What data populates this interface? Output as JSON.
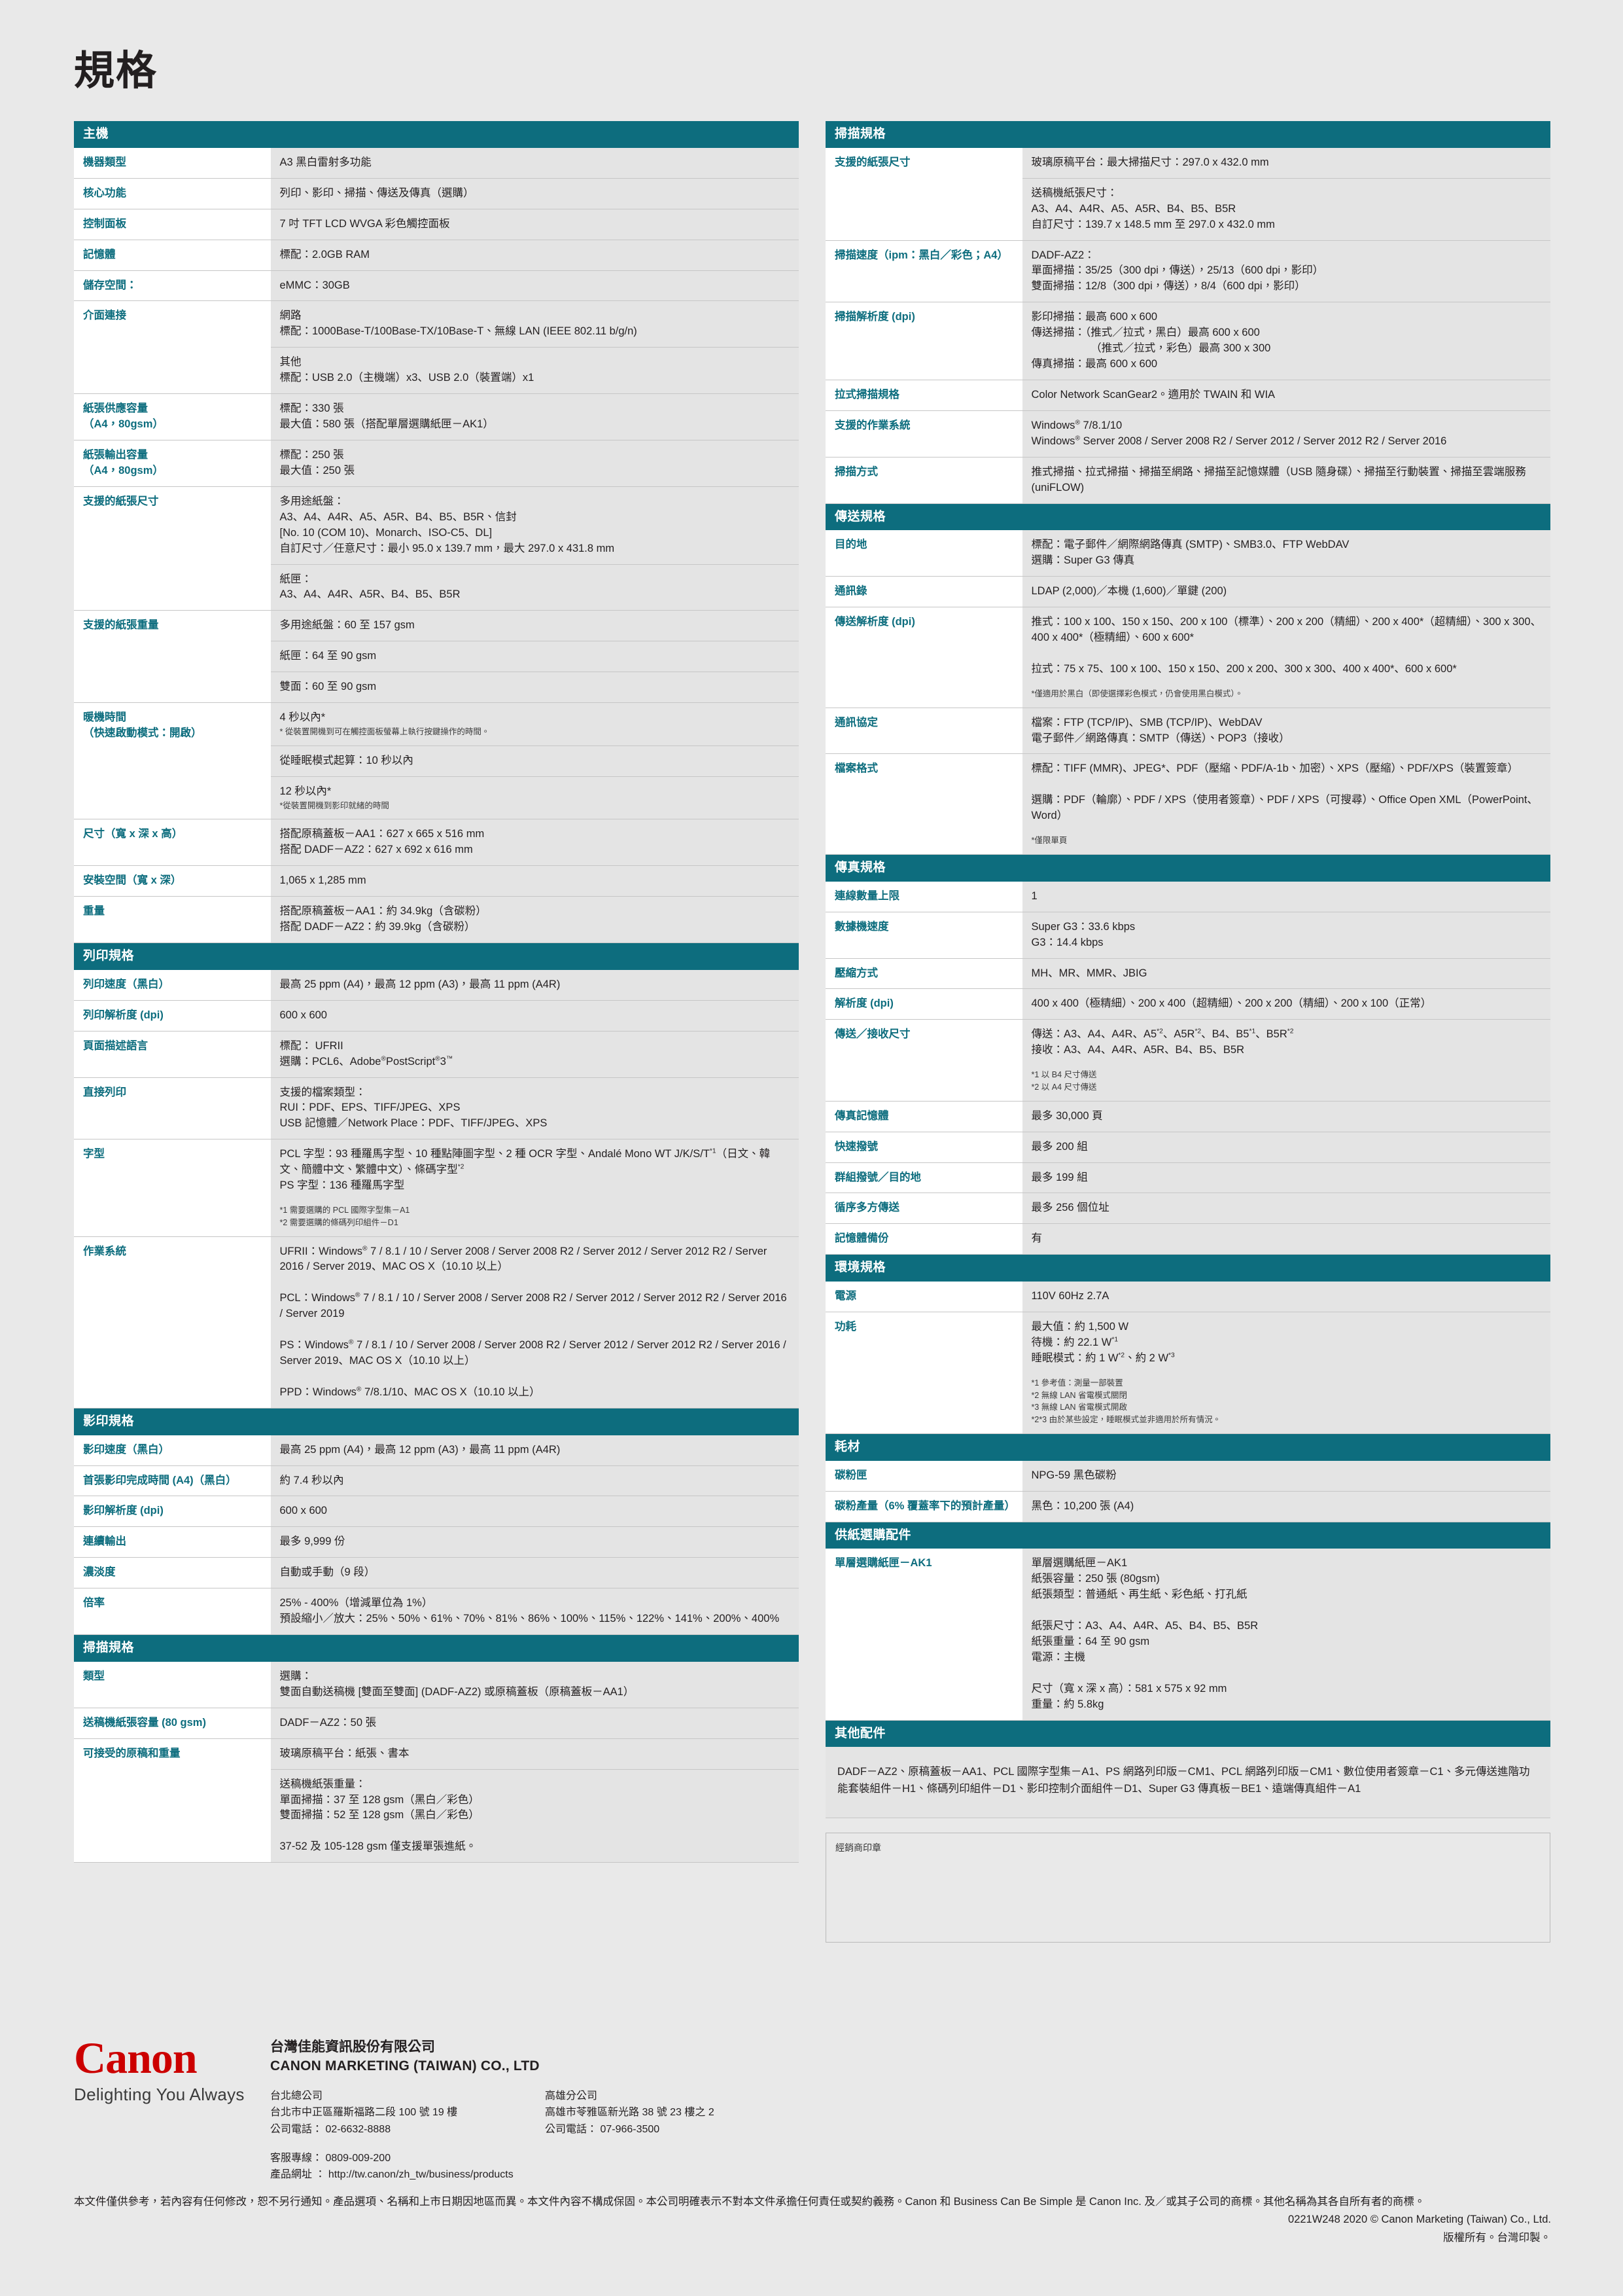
{
  "page_title": "規格",
  "colors": {
    "accent": "#0d6d7e",
    "brand": "#cc0000",
    "value_bg": "#e4e4e4",
    "page_bg": "#e9e9e9"
  },
  "left_column": [
    {
      "section": "主機",
      "rows": [
        {
          "key": "機器類型",
          "values": [
            "A3 黑白雷射多功能"
          ]
        },
        {
          "key": "核心功能",
          "values": [
            "列印、影印、掃描、傳送及傳真（選購）"
          ]
        },
        {
          "key": "控制面板",
          "values": [
            "7 吋 TFT LCD WVGA 彩色觸控面板"
          ]
        },
        {
          "key": "記憶體",
          "values": [
            "標配：2.0GB RAM"
          ]
        },
        {
          "key": "儲存空間：",
          "values": [
            "eMMC：30GB"
          ]
        },
        {
          "key": "介面連接",
          "values": [
            "網路\n標配：1000Base-T/100Base-TX/10Base-T、無線 LAN (IEEE 802.11 b/g/n)",
            "其他\n標配：USB 2.0（主機端）x3、USB 2.0（裝置端）x1"
          ]
        },
        {
          "key": "紙張供應容量\n（A4，80gsm）",
          "values": [
            "標配：330 張\n最大值：580 張（搭配單層選購紙匣－AK1）"
          ]
        },
        {
          "key": "紙張輸出容量\n（A4，80gsm）",
          "values": [
            "標配：250 張\n最大值：250 張"
          ]
        },
        {
          "key": "支援的紙張尺寸",
          "values": [
            "多用途紙盤：\nA3、A4、A4R、A5、A5R、B4、B5、B5R、信封\n[No. 10 (COM 10)、Monarch、ISO-C5、DL]\n自訂尺寸／任意尺寸：最小 95.0 x 139.7 mm，最大 297.0 x 431.8 mm",
            "紙匣：\nA3、A4、A4R、A5R、B4、B5、B5R"
          ]
        },
        {
          "key": "支援的紙張重量",
          "values": [
            "多用途紙盤：60 至 157 gsm",
            "紙匣：64 至 90 gsm",
            "雙面：60 至 90 gsm"
          ]
        },
        {
          "key": "暖機時間\n（快速啟動模式：開啟）",
          "values": [
            "4 秒以內*",
            "從睡眠模式起算：10 秒以內",
            "12 秒以內*"
          ],
          "value_notes": [
            "* 從裝置開機到可在觸控面板螢幕上執行按鍵操作的時間。",
            "",
            "*從裝置開機到影印就緒的時間"
          ]
        },
        {
          "key": "尺寸（寬 x 深 x 高）",
          "values": [
            "搭配原稿蓋板－AA1：627 x 665 x 516 mm\n搭配 DADF－AZ2：627 x 692 x 616 mm"
          ]
        },
        {
          "key": "安裝空間（寬 x 深）",
          "values": [
            "1,065 x 1,285 mm"
          ]
        },
        {
          "key": "重量",
          "values": [
            "搭配原稿蓋板－AA1：約 34.9kg（含碳粉）\n搭配 DADF－AZ2：約 39.9kg（含碳粉）"
          ]
        }
      ]
    },
    {
      "section": "列印規格",
      "rows": [
        {
          "key": "列印速度（黑白）",
          "values": [
            "最高 25 ppm (A4)，最高 12 ppm (A3)，最高 11 ppm (A4R)"
          ]
        },
        {
          "key": "列印解析度 (dpi)",
          "values": [
            "600 x 600"
          ]
        },
        {
          "key": "頁面描述語言",
          "values": [
            "標配： UFRII\n選購：PCL6、Adobe®PostScript®3™"
          ]
        },
        {
          "key": "直接列印",
          "values": [
            "支援的檔案類型：\nRUI：PDF、EPS、TIFF/JPEG、XPS\nUSB 記憶體／Network Place：PDF、TIFF/JPEG、XPS"
          ]
        },
        {
          "key": "字型",
          "values": [
            "PCL 字型：93 種羅馬字型、10 種點陣圖字型、2 種 OCR 字型、Andalé Mono WT J/K/S/T*1（日文、韓文、簡體中文、繁體中文）、條碼字型*2\nPS 字型：136 種羅馬字型"
          ],
          "value_notes": [
            "*1 需要選購的 PCL 國際字型集－A1\n*2 需要選購的條碼列印組件－D1"
          ]
        },
        {
          "key": "作業系統",
          "values": [
            "UFRII：Windows® 7 / 8.1 / 10 / Server 2008 / Server 2008 R2 / Server 2012 / Server 2012 R2 / Server 2016 / Server 2019、MAC OS X（10.10 以上）\n\nPCL：Windows® 7 / 8.1 / 10 / Server 2008 / Server 2008 R2 / Server 2012 / Server 2012 R2 / Server 2016 / Server 2019\n\nPS：Windows® 7 / 8.1 / 10 / Server 2008 / Server 2008 R2 / Server 2012 / Server 2012 R2 / Server 2016 / Server 2019、MAC OS X（10.10 以上）\n\nPPD：Windows® 7/8.1/10、MAC OS X（10.10 以上）"
          ]
        }
      ]
    },
    {
      "section": "影印規格",
      "rows": [
        {
          "key": "影印速度（黑白）",
          "values": [
            "最高 25 ppm (A4)，最高 12 ppm (A3)，最高 11 ppm (A4R)"
          ]
        },
        {
          "key": "首張影印完成時間 (A4)（黑白）",
          "values": [
            "約 7.4 秒以內"
          ]
        },
        {
          "key": "影印解析度 (dpi)",
          "values": [
            "600 x 600"
          ]
        },
        {
          "key": "連續輸出",
          "values": [
            "最多 9,999 份"
          ]
        },
        {
          "key": "濃淡度",
          "values": [
            "自動或手動（9 段）"
          ]
        },
        {
          "key": "倍率",
          "values": [
            "25% - 400%（增減單位為 1%）\n預設縮小／放大：25%、50%、61%、70%、81%、86%、100%、115%、122%、141%、200%、400%"
          ]
        }
      ]
    },
    {
      "section": "掃描規格",
      "rows": [
        {
          "key": "類型",
          "values": [
            "選購：\n雙面自動送稿機 [雙面至雙面] (DADF-AZ2) 或原稿蓋板（原稿蓋板－AA1）"
          ]
        },
        {
          "key": "送稿機紙張容量 (80 gsm)",
          "values": [
            "DADF－AZ2：50 張"
          ]
        },
        {
          "key": "可接受的原稿和重量",
          "values": [
            "玻璃原稿平台：紙張、書本",
            "送稿機紙張重量：\n單面掃描：37 至 128 gsm（黑白／彩色）\n雙面掃描：52 至 128 gsm（黑白／彩色）\n\n37-52 及 105-128 gsm 僅支援單張進紙。"
          ]
        }
      ]
    }
  ],
  "right_column": [
    {
      "section": "掃描規格",
      "rows": [
        {
          "key": "支援的紙張尺寸",
          "values": [
            "玻璃原稿平台：最大掃描尺寸：297.0 x 432.0 mm",
            "送稿機紙張尺寸：\nA3、A4、A4R、A5、A5R、B4、B5、B5R\n自訂尺寸：139.7 x 148.5 mm 至 297.0 x 432.0 mm"
          ]
        },
        {
          "key": "掃描速度（ipm：黑白／彩色；A4）",
          "values": [
            "DADF-AZ2：\n單面掃描：35/25（300 dpi，傳送），25/13（600 dpi，影印）\n雙面掃描：12/8（300 dpi，傳送），8/4（600 dpi，影印）"
          ]
        },
        {
          "key": "掃描解析度 (dpi)",
          "values": [
            "影印掃描：最高 600 x 600\n傳送掃描：（推式／拉式，黑白）最高 600 x 600\n　　　　　　（推式／拉式，彩色）最高 300 x 300\n傳真掃描：最高 600 x 600"
          ]
        },
        {
          "key": "拉式掃描規格",
          "values": [
            "Color Network ScanGear2。適用於 TWAIN 和 WIA"
          ]
        },
        {
          "key": "支援的作業系統",
          "values": [
            "Windows® 7/8.1/10\nWindows® Server 2008 / Server 2008 R2 / Server 2012 / Server 2012 R2 / Server 2016"
          ]
        },
        {
          "key": "掃描方式",
          "values": [
            "推式掃描、拉式掃描、掃描至網路、掃描至記憶媒體（USB 隨身碟）、掃描至行動裝置、掃描至雲端服務 (uniFLOW)"
          ]
        }
      ]
    },
    {
      "section": "傳送規格",
      "rows": [
        {
          "key": "目的地",
          "values": [
            "標配：電子郵件／網際網路傳真 (SMTP)、SMB3.0、FTP WebDAV\n選購：Super G3 傳真"
          ]
        },
        {
          "key": "通訊錄",
          "values": [
            "LDAP (2,000)／本機 (1,600)／單鍵 (200)"
          ]
        },
        {
          "key": "傳送解析度 (dpi)",
          "values": [
            "推式：100 x 100、150 x 150、200 x 100（標準）、200 x 200（精細）、200 x 400*（超精細）、300 x 300、400 x 400*（極精細）、600 x 600*\n\n拉式：75 x 75、100 x 100、150 x 150、200 x 200、300 x 300、400 x 400*、600 x 600*"
          ],
          "value_notes": [
            "*僅適用於黑白（即使選擇彩色模式，仍會使用黑白模式）。"
          ]
        },
        {
          "key": "通訊協定",
          "values": [
            "檔案：FTP (TCP/IP)、SMB (TCP/IP)、WebDAV\n電子郵件／網路傳真：SMTP（傳送）、POP3（接收）"
          ]
        },
        {
          "key": "檔案格式",
          "values": [
            "標配：TIFF (MMR)、JPEG*、PDF（壓縮、PDF/A-1b、加密）、XPS（壓縮）、PDF/XPS（裝置簽章）\n\n選購：PDF（輪廓）、PDF / XPS（使用者簽章）、PDF / XPS（可搜尋）、Office Open XML（PowerPoint、Word）"
          ],
          "value_notes": [
            "*僅限單頁"
          ]
        }
      ]
    },
    {
      "section": "傳真規格",
      "rows": [
        {
          "key": "連線數量上限",
          "values": [
            "1"
          ]
        },
        {
          "key": "數據機速度",
          "values": [
            "Super G3：33.6 kbps\nG3：14.4 kbps"
          ]
        },
        {
          "key": "壓縮方式",
          "values": [
            "MH、MR、MMR、JBIG"
          ]
        },
        {
          "key": "解析度 (dpi)",
          "values": [
            "400 x 400（極精細）、200 x 400（超精細）、200 x 200（精細）、200 x 100（正常）"
          ]
        },
        {
          "key": "傳送／接收尺寸",
          "values": [
            "傳送：A3、A4、A4R、A5*2、A5R*2、B4、B5*1、B5R*2\n接收：A3、A4、A4R、A5R、B4、B5、B5R"
          ],
          "value_notes": [
            "*1 以 B4 尺寸傳送\n*2 以 A4 尺寸傳送"
          ]
        },
        {
          "key": "傳真記憶體",
          "values": [
            "最多 30,000 頁"
          ]
        },
        {
          "key": "快速撥號",
          "values": [
            "最多 200 組"
          ]
        },
        {
          "key": "群組撥號／目的地",
          "values": [
            "最多 199 組"
          ]
        },
        {
          "key": "循序多方傳送",
          "values": [
            "最多 256 個位址"
          ]
        },
        {
          "key": "記憶體備份",
          "values": [
            "有"
          ]
        }
      ]
    },
    {
      "section": "環境規格",
      "rows": [
        {
          "key": "電源",
          "values": [
            "110V 60Hz 2.7A"
          ]
        },
        {
          "key": "功耗",
          "values": [
            "最大值：約 1,500 W\n待機：約 22.1 W*1\n睡眠模式：約 1 W*2、約 2 W*3"
          ],
          "value_notes": [
            "*1 參考值：測量一部裝置\n*2 無線 LAN 省電模式關閉\n*3 無線 LAN 省電模式開啟\n*2*3 由於某些設定，睡眠模式並非適用於所有情況。"
          ]
        }
      ]
    },
    {
      "section": "耗材",
      "rows": [
        {
          "key": "碳粉匣",
          "values": [
            "NPG-59 黑色碳粉"
          ]
        },
        {
          "key": "碳粉產量（6% 覆蓋率下的預計產量）",
          "values": [
            "黑色：10,200 張 (A4)"
          ]
        }
      ]
    },
    {
      "section": "供紙選購配件",
      "rows": [
        {
          "key": "單層選購紙匣－AK1",
          "values": [
            "單層選購紙匣－AK1\n紙張容量：250 張 (80gsm)\n紙張類型：普通紙、再生紙、彩色紙、打孔紙\n\n紙張尺寸：A3、A4、A4R、A5、B4、B5、B5R\n紙張重量：64 至 90 gsm\n電源：主機\n\n尺寸（寬 x 深 x 高）：581 x 575 x 92 mm\n重量：約 5.8kg"
          ]
        }
      ]
    }
  ],
  "other_accessories": {
    "section": "其他配件",
    "text": "DADF－AZ2、原稿蓋板－AA1、PCL 國際字型集－A1、PS 網路列印版－CM1、PCL 網路列印版－CM1、數位使用者簽章－C1、多元傳送進階功能套裝組件－H1、條碼列印組件－D1、影印控制介面組件－D1、Super G3 傳真板－BE1、遠端傳真組件－A1"
  },
  "dealer_stamp": {
    "label": "經銷商印章"
  },
  "footer": {
    "logo_text": "Canon",
    "tagline": "Delighting You Always",
    "company_cn": "台灣佳能資訊股份有限公司",
    "company_en": "CANON MARKETING (TAIWAN) CO., LTD",
    "offices": [
      {
        "name": "台北總公司",
        "address": "台北市中正區羅斯福路二段 100 號 19 樓",
        "phone": "公司電話： 02-6632-8888"
      },
      {
        "name": "高雄分公司",
        "address": "高雄市苓雅區新光路 38 號 23 樓之 2",
        "phone": "公司電話： 07-966-3500"
      }
    ],
    "service_line": "客服專線： 0809-009-200",
    "product_url": "產品網址 ： http://tw.canon/zh_tw/business/products",
    "disclaimer": "本文件僅供參考，若內容有任何修改，恕不另行通知。產品選項、名稱和上市日期因地區而異。本文件內容不構成保固。本公司明確表示不對本文件承擔任何責任或契約義務。Canon 和 Business Can Be Simple 是 Canon Inc. 及／或其子公司的商標。其他名稱為其各自所有者的商標。",
    "copyright": "0221W248  2020 © Canon Marketing (Taiwan) Co., Ltd.",
    "rights": "版權所有。台灣印製。"
  }
}
